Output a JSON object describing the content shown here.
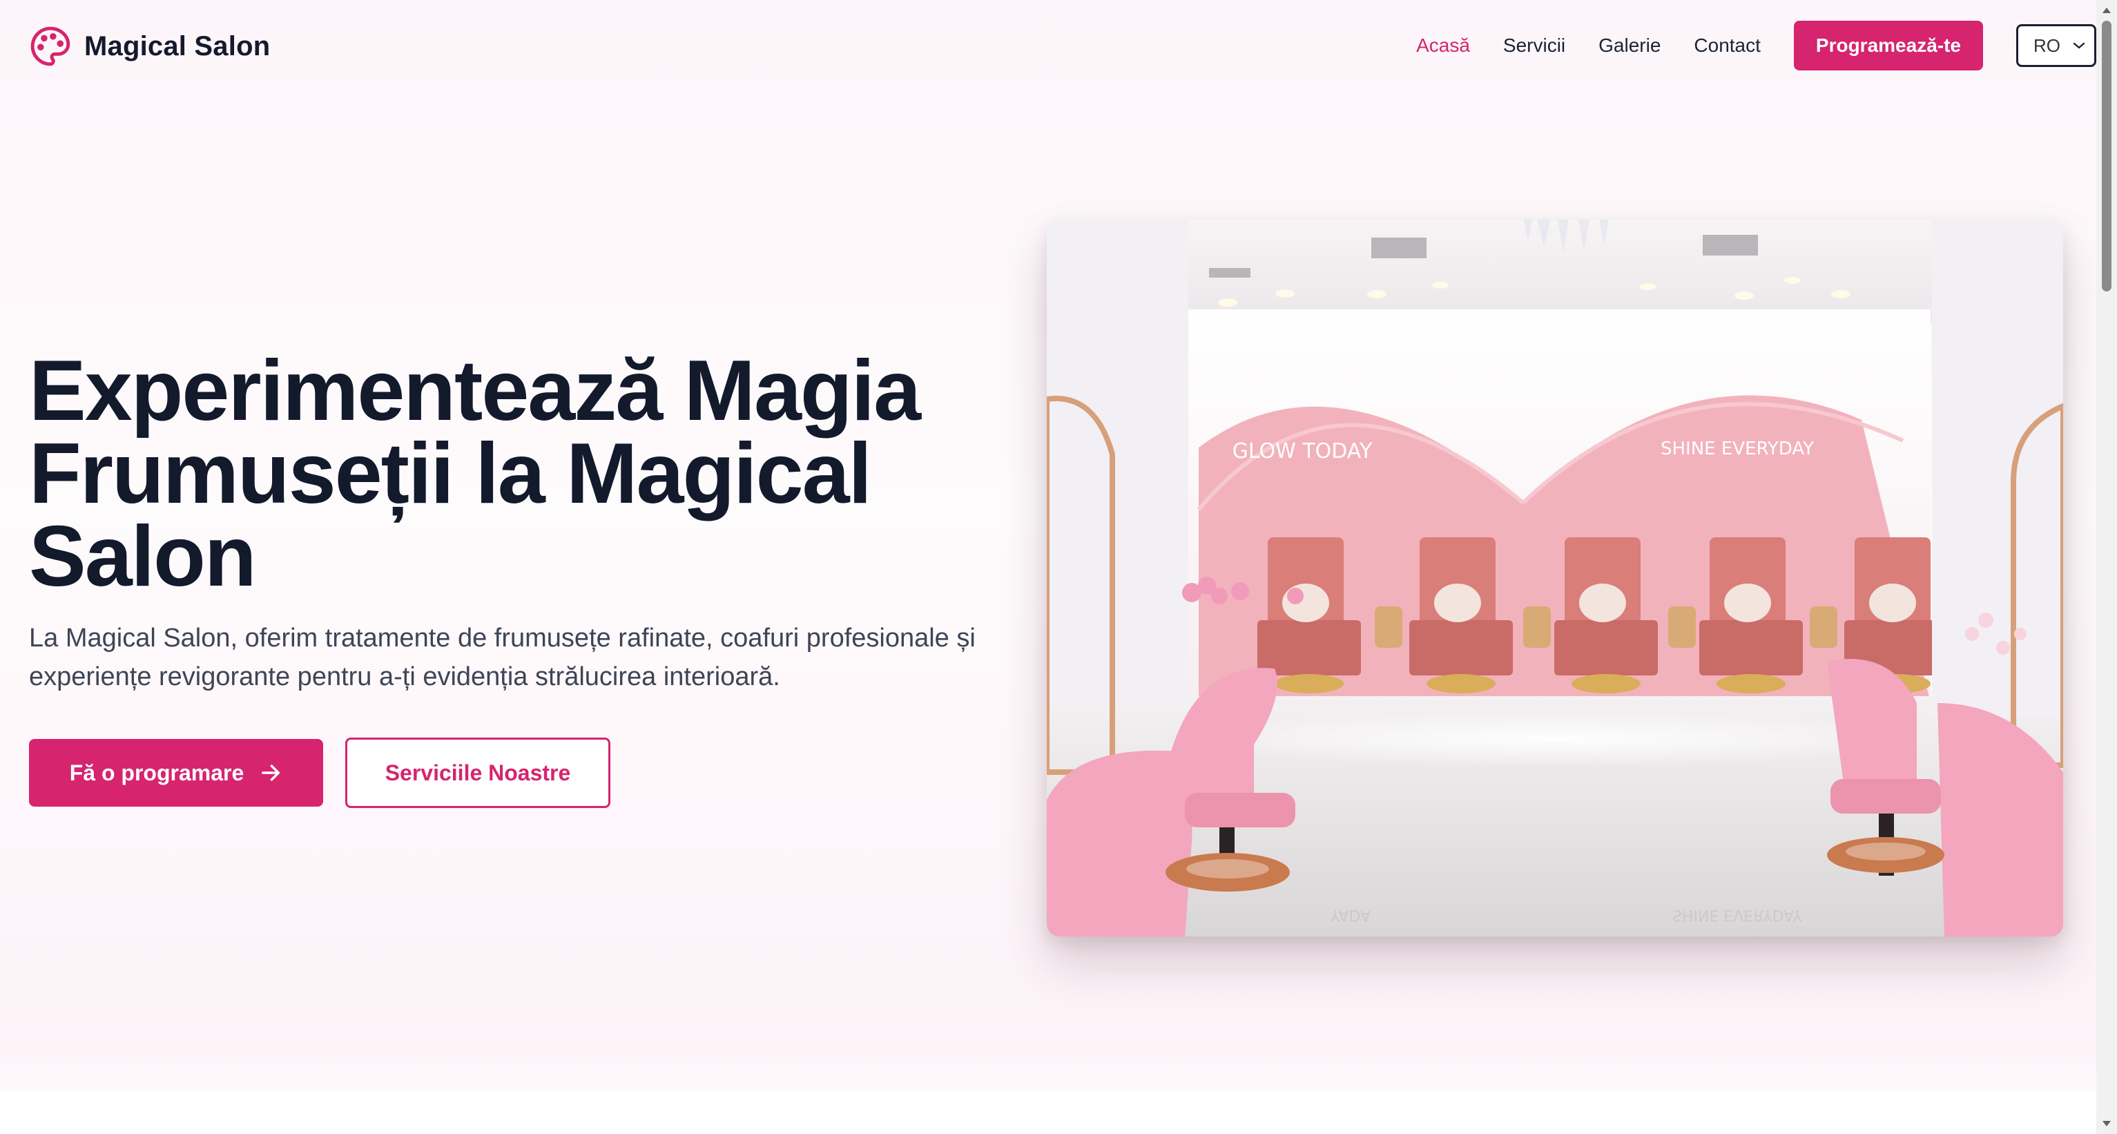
{
  "header": {
    "brand_name": "Magical Salon",
    "nav": [
      {
        "label": "Acasă",
        "active": true
      },
      {
        "label": "Servicii",
        "active": false
      },
      {
        "label": "Galerie",
        "active": false
      },
      {
        "label": "Contact",
        "active": false
      }
    ],
    "cta_label": "Programează-te",
    "language": {
      "selected": "RO"
    }
  },
  "hero": {
    "title_lines": [
      "Experimentează Magia",
      "Frumuseții la Magical",
      "Salon"
    ],
    "description_lines": [
      "La Magical Salon, oferim tratamente de frumusețe rafinate, coafuri profesionale și",
      "experiențe revigorante pentru a-ți evidenția strălucirea interioară."
    ],
    "primary_button": "Fă o programare",
    "secondary_button": "Serviciile Noastre",
    "image": {
      "wall_signs": [
        "GLOW TODAY",
        "SHINE EVERYDAY"
      ],
      "floor_reflection_signs": [
        "YADA",
        "SHINE EVERYDAY"
      ]
    }
  },
  "colors": {
    "accent": "#d6246e",
    "heading": "#121a2c",
    "body_text": "#3d4556"
  },
  "icons": {
    "brand": "palette-icon",
    "primary_button": "arrow-right-icon",
    "select": "chevron-down-icon"
  }
}
